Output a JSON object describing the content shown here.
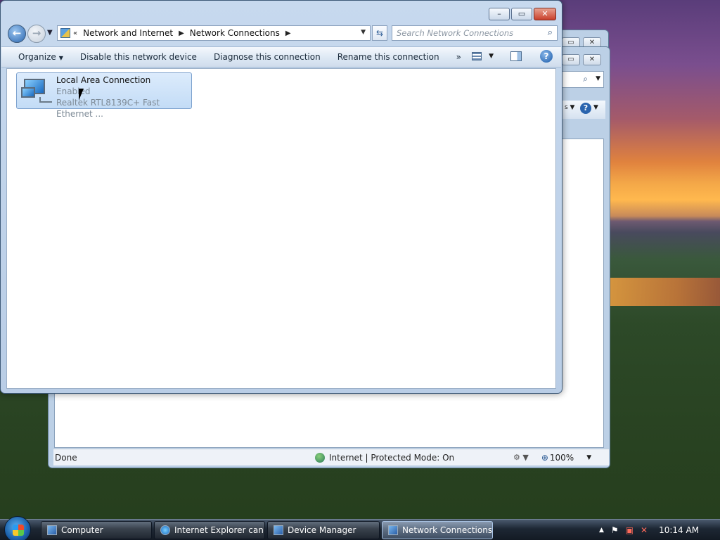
{
  "window": {
    "title": "Network Connections"
  },
  "navigation": {
    "breadcrumbs": [
      "Network and Internet",
      "Network Connections"
    ],
    "search_placeholder": "Search Network Connections"
  },
  "toolbar": {
    "organize": "Organize",
    "disable": "Disable this network device",
    "diagnose": "Diagnose this connection",
    "rename": "Rename this connection",
    "more": "»"
  },
  "connection": {
    "name": "Local Area Connection",
    "status": "Enabled",
    "device": "Realtek RTL8139C+ Fast Ethernet ..."
  },
  "ie_status": {
    "state": "Done",
    "zone": "Internet | Protected Mode: On",
    "zoom": "100%"
  },
  "taskbar": {
    "tasks": [
      "Computer",
      "Internet Explorer can...",
      "Device Manager",
      "Network Connections"
    ],
    "clock": "10:14 AM"
  }
}
